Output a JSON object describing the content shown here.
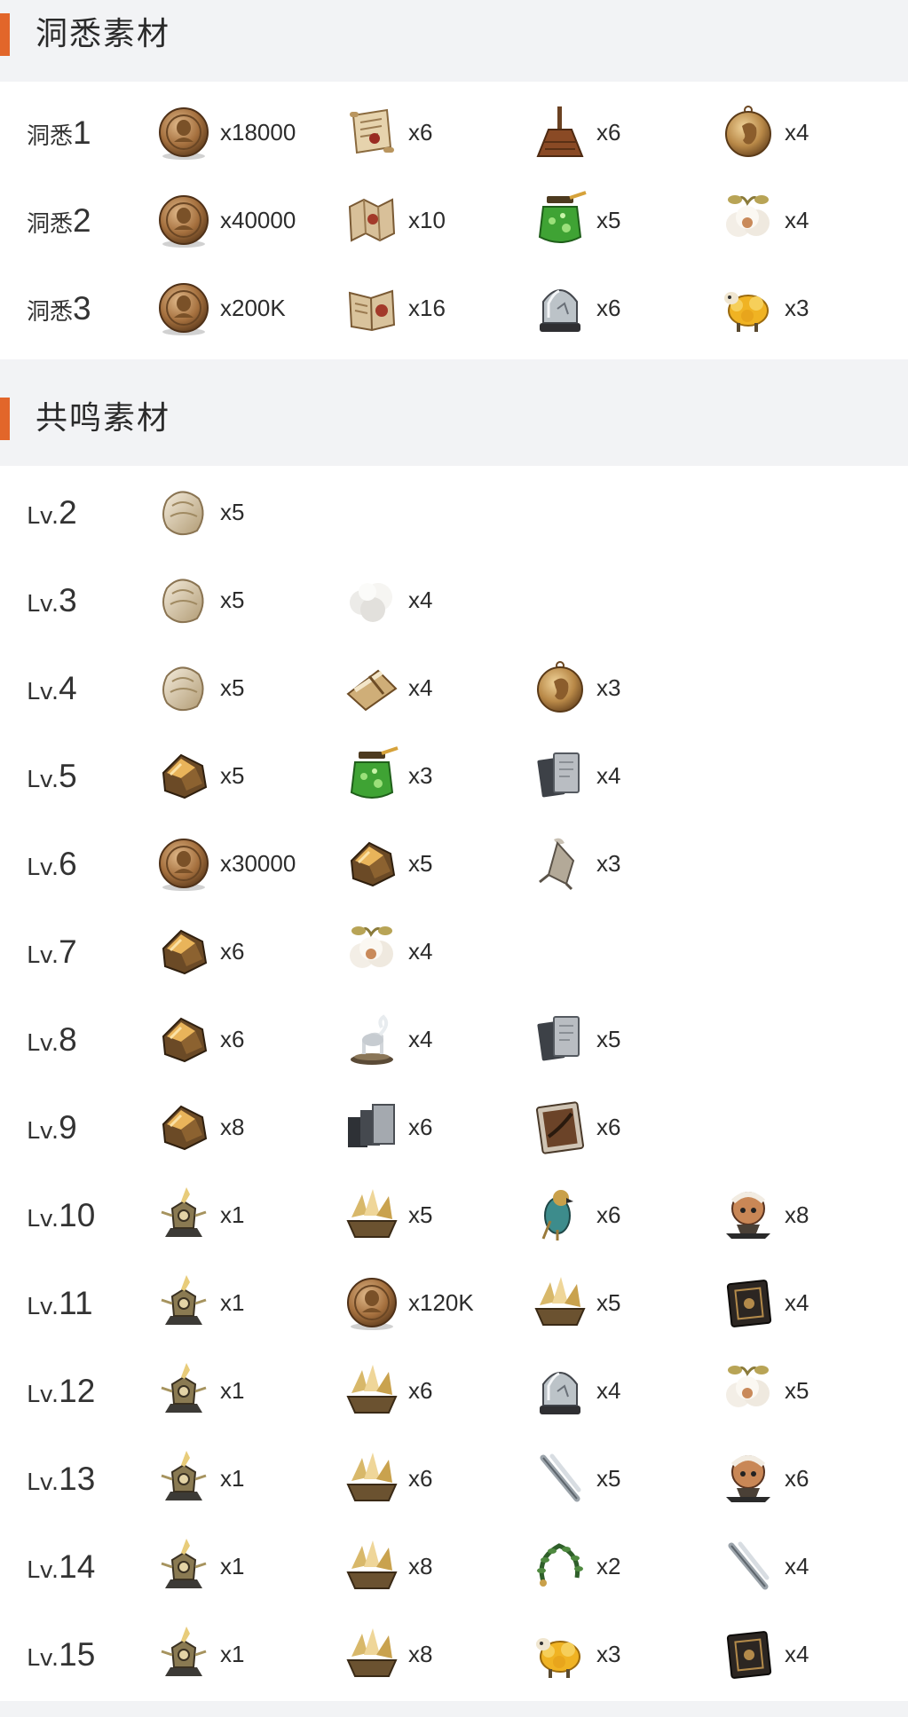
{
  "sections": [
    {
      "title": "洞悉素材",
      "rows": [
        {
          "prefix": "洞悉",
          "num": "1",
          "items": [
            {
              "icon": "bronze-coin-icon",
              "qty": "x18000"
            },
            {
              "icon": "scroll-icon",
              "qty": "x6"
            },
            {
              "icon": "broom-icon",
              "qty": "x6"
            },
            {
              "icon": "gold-medal-icon",
              "qty": "x4"
            }
          ]
        },
        {
          "prefix": "洞悉",
          "num": "2",
          "items": [
            {
              "icon": "bronze-coin-icon",
              "qty": "x40000"
            },
            {
              "icon": "folded-map-icon",
              "qty": "x10"
            },
            {
              "icon": "green-jar-icon",
              "qty": "x5"
            },
            {
              "icon": "cotton-plant-icon",
              "qty": "x4"
            }
          ]
        },
        {
          "prefix": "洞悉",
          "num": "3",
          "items": [
            {
              "icon": "bronze-coin-icon",
              "qty": "x200K"
            },
            {
              "icon": "open-book-icon",
              "qty": "x16"
            },
            {
              "icon": "glass-dome-icon",
              "qty": "x6"
            },
            {
              "icon": "golden-sheep-icon",
              "qty": "x3"
            }
          ]
        }
      ]
    },
    {
      "title": "共鸣素材",
      "rows": [
        {
          "prefix": "Lv.",
          "num": "2",
          "items": [
            {
              "icon": "pale-stone-icon",
              "qty": "x5"
            }
          ]
        },
        {
          "prefix": "Lv.",
          "num": "3",
          "items": [
            {
              "icon": "pale-stone-icon",
              "qty": "x5"
            },
            {
              "icon": "white-fluff-icon",
              "qty": "x4"
            }
          ]
        },
        {
          "prefix": "Lv.",
          "num": "4",
          "items": [
            {
              "icon": "pale-stone-icon",
              "qty": "x5"
            },
            {
              "icon": "parchment-bundle-icon",
              "qty": "x4"
            },
            {
              "icon": "gold-medal-icon",
              "qty": "x3"
            }
          ]
        },
        {
          "prefix": "Lv.",
          "num": "5",
          "items": [
            {
              "icon": "amber-ore-icon",
              "qty": "x5"
            },
            {
              "icon": "green-jar-icon",
              "qty": "x3"
            },
            {
              "icon": "metal-plates-icon",
              "qty": "x4"
            }
          ]
        },
        {
          "prefix": "Lv.",
          "num": "6",
          "items": [
            {
              "icon": "bronze-coin-icon",
              "qty": "x30000"
            },
            {
              "icon": "amber-ore-icon",
              "qty": "x5"
            },
            {
              "icon": "bone-charm-icon",
              "qty": "x3"
            }
          ]
        },
        {
          "prefix": "Lv.",
          "num": "7",
          "items": [
            {
              "icon": "amber-ore-icon",
              "qty": "x6"
            },
            {
              "icon": "cotton-plant-icon",
              "qty": "x4"
            }
          ]
        },
        {
          "prefix": "Lv.",
          "num": "8",
          "items": [
            {
              "icon": "amber-ore-icon",
              "qty": "x6"
            },
            {
              "icon": "ram-statue-icon",
              "qty": "x4"
            },
            {
              "icon": "metal-plates-icon",
              "qty": "x5"
            }
          ]
        },
        {
          "prefix": "Lv.",
          "num": "9",
          "items": [
            {
              "icon": "amber-ore-icon",
              "qty": "x8"
            },
            {
              "icon": "iron-blocks-icon",
              "qty": "x6"
            },
            {
              "icon": "feather-card-icon",
              "qty": "x6"
            }
          ]
        },
        {
          "prefix": "Lv.",
          "num": "10",
          "items": [
            {
              "icon": "ornate-trophy-icon",
              "qty": "x1"
            },
            {
              "icon": "golden-crystal-icon",
              "qty": "x5"
            },
            {
              "icon": "falcon-icon",
              "qty": "x6"
            },
            {
              "icon": "mask-totem-icon",
              "qty": "x8"
            }
          ]
        },
        {
          "prefix": "Lv.",
          "num": "11",
          "items": [
            {
              "icon": "ornate-trophy-icon",
              "qty": "x1"
            },
            {
              "icon": "bronze-coin-icon",
              "qty": "x120K"
            },
            {
              "icon": "golden-crystal-icon",
              "qty": "x5"
            },
            {
              "icon": "dark-tome-icon",
              "qty": "x4"
            }
          ]
        },
        {
          "prefix": "Lv.",
          "num": "12",
          "items": [
            {
              "icon": "ornate-trophy-icon",
              "qty": "x1"
            },
            {
              "icon": "golden-crystal-icon",
              "qty": "x6"
            },
            {
              "icon": "glass-dome-icon",
              "qty": "x4"
            },
            {
              "icon": "cotton-plant-icon",
              "qty": "x5"
            }
          ]
        },
        {
          "prefix": "Lv.",
          "num": "13",
          "items": [
            {
              "icon": "ornate-trophy-icon",
              "qty": "x1"
            },
            {
              "icon": "golden-crystal-icon",
              "qty": "x6"
            },
            {
              "icon": "crossed-blades-icon",
              "qty": "x5"
            },
            {
              "icon": "mask-totem-icon",
              "qty": "x6"
            }
          ]
        },
        {
          "prefix": "Lv.",
          "num": "14",
          "items": [
            {
              "icon": "ornate-trophy-icon",
              "qty": "x1"
            },
            {
              "icon": "golden-crystal-icon",
              "qty": "x8"
            },
            {
              "icon": "laurel-wreath-icon",
              "qty": "x2"
            },
            {
              "icon": "crossed-blades-icon",
              "qty": "x4"
            }
          ]
        },
        {
          "prefix": "Lv.",
          "num": "15",
          "items": [
            {
              "icon": "ornate-trophy-icon",
              "qty": "x1"
            },
            {
              "icon": "golden-crystal-icon",
              "qty": "x8"
            },
            {
              "icon": "golden-sheep-icon",
              "qty": "x3"
            },
            {
              "icon": "dark-tome-icon",
              "qty": "x4"
            }
          ]
        }
      ]
    }
  ],
  "colors": {
    "accent": "#e2662a",
    "header_bg": "#f2f3f5",
    "body_bg": "#ffffff",
    "text": "#2c2c2c"
  }
}
